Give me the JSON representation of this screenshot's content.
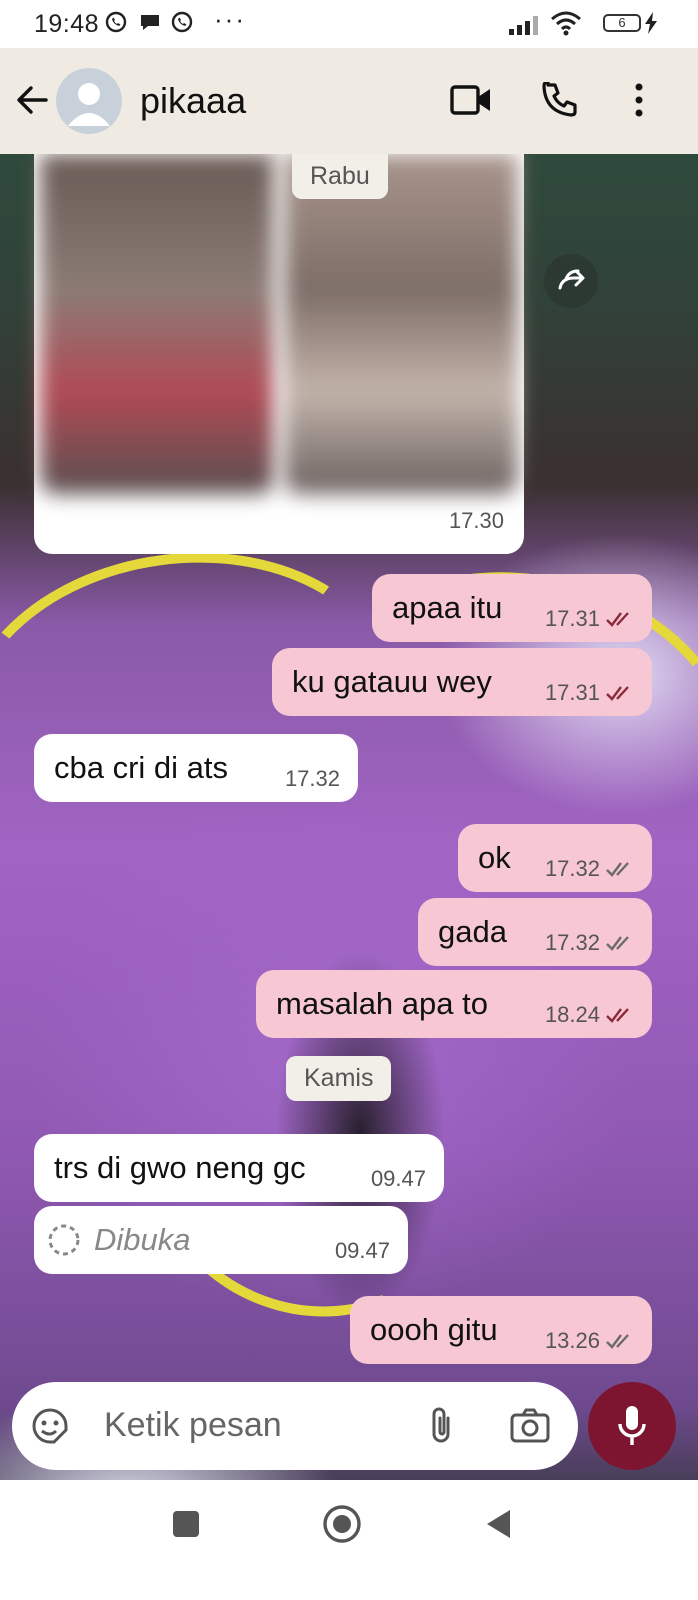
{
  "status_bar": {
    "time": "19:48",
    "notif_overflow": "···",
    "battery": "6"
  },
  "header": {
    "contact_name": "pikaaa"
  },
  "colors": {
    "header_bg": "#efebe3",
    "outgoing_bubble": "#f7c7d4",
    "incoming_bubble": "#ffffff",
    "mic_button": "#7d1530",
    "read_ticks": "#8a2a3a",
    "delivered_ticks": "#6b6b6b"
  },
  "chat": {
    "media_message": {
      "time": "17.30"
    },
    "day_chips": [
      "Rabu",
      "Kamis"
    ],
    "messages": [
      {
        "dir": "out",
        "text": "apaa itu",
        "time": "17.31",
        "status": "read"
      },
      {
        "dir": "out",
        "text": "ku gatauu wey",
        "time": "17.31",
        "status": "read"
      },
      {
        "dir": "in",
        "text": "cba cri di ats",
        "time": "17.32"
      },
      {
        "dir": "out",
        "text": "ok",
        "time": "17.32",
        "status": "delivered"
      },
      {
        "dir": "out",
        "text": "gada",
        "time": "17.32",
        "status": "delivered"
      },
      {
        "dir": "out",
        "text": "masalah apa to",
        "time": "18.24",
        "status": "read"
      },
      {
        "dir": "in",
        "text": "trs di gwo neng gc",
        "time": "09.47"
      },
      {
        "dir": "in",
        "text": "Dibuka",
        "time": "09.47",
        "view_once": true
      },
      {
        "dir": "out",
        "text": "oooh gitu",
        "time": "13.26",
        "status": "delivered"
      }
    ]
  },
  "composer": {
    "placeholder": "Ketik pesan"
  }
}
